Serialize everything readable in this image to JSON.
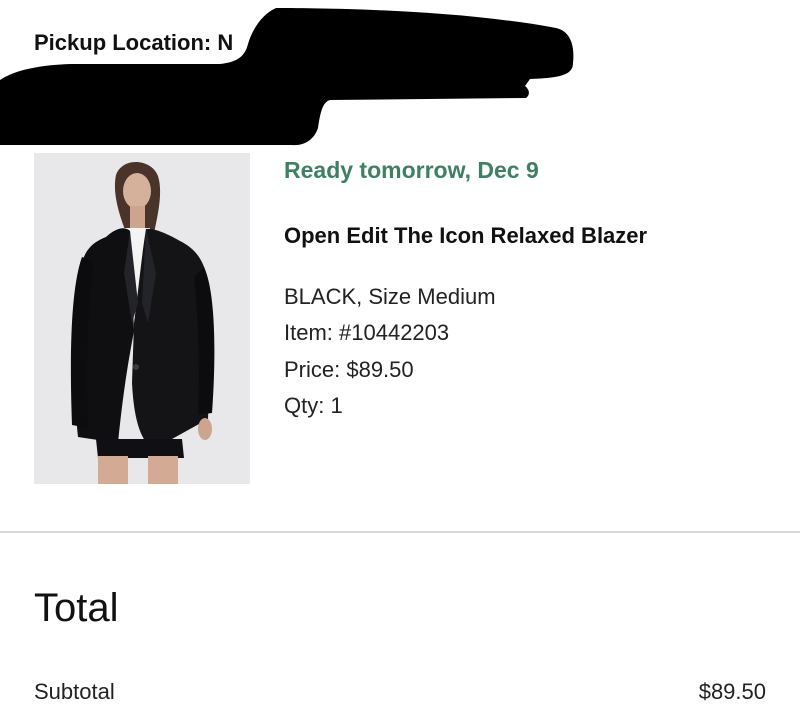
{
  "pickup": {
    "label": "Pickup Location: N"
  },
  "item": {
    "ready_text": "Ready tomorrow, Dec 9",
    "ready_color": "#3f7f63",
    "name": "Open Edit The Icon Relaxed Blazer",
    "variant": "BLACK, Size Medium",
    "item_number": "Item: #10442203",
    "price": "Price: $89.50",
    "quantity": "Qty: 1"
  },
  "summary": {
    "heading": "Total",
    "subtotal_label": "Subtotal",
    "subtotal_value": "$89.50"
  },
  "colors": {
    "redaction": "#000000",
    "divider": "#d7d7d7",
    "image_background": "#e8e7ea"
  }
}
